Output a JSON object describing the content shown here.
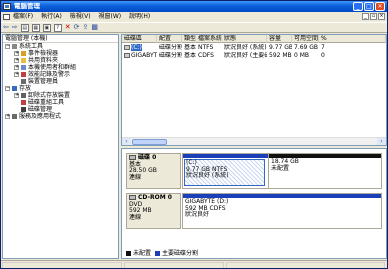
{
  "window": {
    "title": "電腦管理",
    "controls": [
      "minimize",
      "maximize",
      "close"
    ]
  },
  "menu": [
    "檔案(F)",
    "執行(A)",
    "檢視(V)",
    "視窗(W)",
    "說明(H)"
  ],
  "toolbar_icons": [
    "back-arrow-icon",
    "forward-arrow-icon",
    "up-folder-icon",
    "show-tree-icon",
    "properties-icon",
    "help-icon",
    "delete-icon",
    "refresh-icon",
    "export-icon",
    "settings-icon"
  ],
  "tree": {
    "header": "電腦管理 (本機)",
    "nodes": [
      {
        "label": "系統工具",
        "level": 0,
        "expander": "−",
        "icon": "tools"
      },
      {
        "label": "事件檢視器",
        "level": 1,
        "expander": "+",
        "icon": "viewer"
      },
      {
        "label": "共用資料夾",
        "level": 1,
        "expander": "+",
        "icon": "folder"
      },
      {
        "label": "本機使用者和群組",
        "level": 1,
        "expander": "+",
        "icon": "users"
      },
      {
        "label": "效能記錄及警示",
        "level": 1,
        "expander": "+",
        "icon": "perf"
      },
      {
        "label": "裝置管理員",
        "level": 1,
        "expander": "",
        "icon": "device"
      },
      {
        "label": "存放",
        "level": 0,
        "expander": "−",
        "icon": "storage"
      },
      {
        "label": "卸除式存放裝置",
        "level": 1,
        "expander": "+",
        "icon": "removable"
      },
      {
        "label": "磁碟重組工具",
        "level": 1,
        "expander": "",
        "icon": "defrag"
      },
      {
        "label": "磁碟管理",
        "level": 1,
        "expander": "",
        "icon": "disk"
      },
      {
        "label": "服務及應用程式",
        "level": 0,
        "expander": "+",
        "icon": "services"
      }
    ]
  },
  "volumes": {
    "columns": [
      "磁碟區",
      "配置",
      "類型",
      "檔案系統",
      "狀態",
      "容量",
      "可用空間",
      "%"
    ],
    "rows": [
      {
        "name": "(C:)",
        "layout": "磁碟分割",
        "type": "基本",
        "fs": "NTFS",
        "status": "狀況良好 (系統)",
        "capacity": "9.77 GB",
        "free": "7.69 GB",
        "pct": "7",
        "selected": true
      },
      {
        "name": "GIGABYTE (D:)",
        "layout": "磁碟分割",
        "type": "基本",
        "fs": "CDFS",
        "status": "狀況良好 (主要磁碟...",
        "capacity": "592 MB",
        "free": "0 MB",
        "pct": "0",
        "selected": false
      }
    ]
  },
  "disks": [
    {
      "title": "磁碟 0",
      "type": "基本",
      "size": "28.50 GB",
      "state": "連線",
      "partitions": [
        {
          "line1": "(C:)",
          "line2": "9.77 GB NTFS",
          "line3": "狀況良好 (系統)",
          "bar": "blue",
          "width_pct": 43,
          "hatched": true
        },
        {
          "line1": "",
          "line2": "18.74 GB",
          "line3": "未配置",
          "bar": "black",
          "width_pct": 57,
          "hatched": false
        }
      ]
    },
    {
      "title": "CD-ROM 0",
      "type": "DVD",
      "size": "592 MB",
      "state": "連線",
      "partitions": [
        {
          "line1": "GIGABYTE (D:)",
          "line2": "592 MB CDFS",
          "line3": "狀況良好",
          "bar": "blue",
          "width_pct": 100,
          "hatched": false
        }
      ]
    }
  ],
  "legend": [
    {
      "label": "未配置",
      "color": "#111111"
    },
    {
      "label": "主要磁碟分割",
      "color": "#1a3fb8"
    }
  ]
}
